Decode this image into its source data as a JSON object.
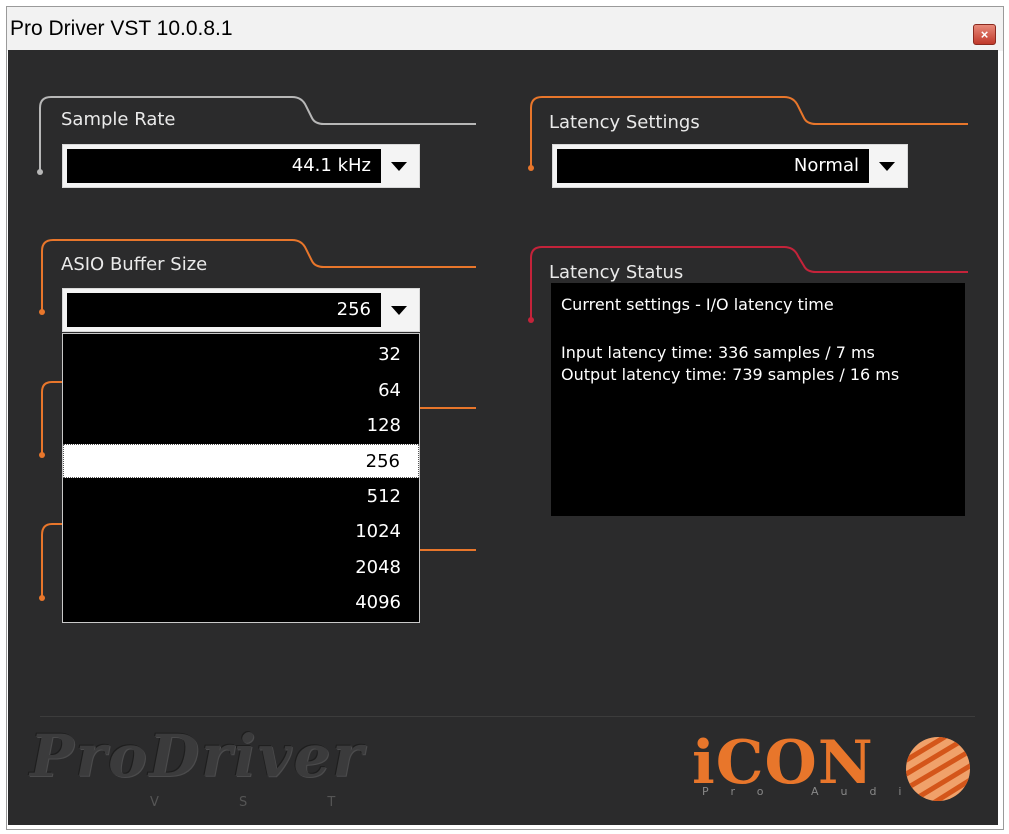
{
  "window": {
    "title": "Pro Driver VST 10.0.8.1",
    "close_icon": "close-icon",
    "accent_orange": "#e8762b",
    "accent_red": "#c4233a",
    "panel_bg": "#2b2b2c"
  },
  "sample_rate": {
    "label": "Sample Rate",
    "value": "44.1 kHz"
  },
  "latency_settings": {
    "label": "Latency Settings",
    "value": "Normal"
  },
  "asio_buffer": {
    "label": "ASIO Buffer Size",
    "value": "256",
    "options": [
      "32",
      "64",
      "128",
      "256",
      "512",
      "1024",
      "2048",
      "4096"
    ],
    "selected": "256"
  },
  "latency_status": {
    "label": "Latency Status",
    "header": "Current settings - I/O latency time",
    "input_latency": "Input latency time: 336 samples / 7 ms",
    "output_latency": "Output latency time: 739 samples / 16 ms"
  },
  "branding": {
    "prodriver_logo": "ProDriver",
    "prodriver_sub": "V S T",
    "icon_logo": "iCON",
    "icon_sub": "Pro Audio"
  }
}
